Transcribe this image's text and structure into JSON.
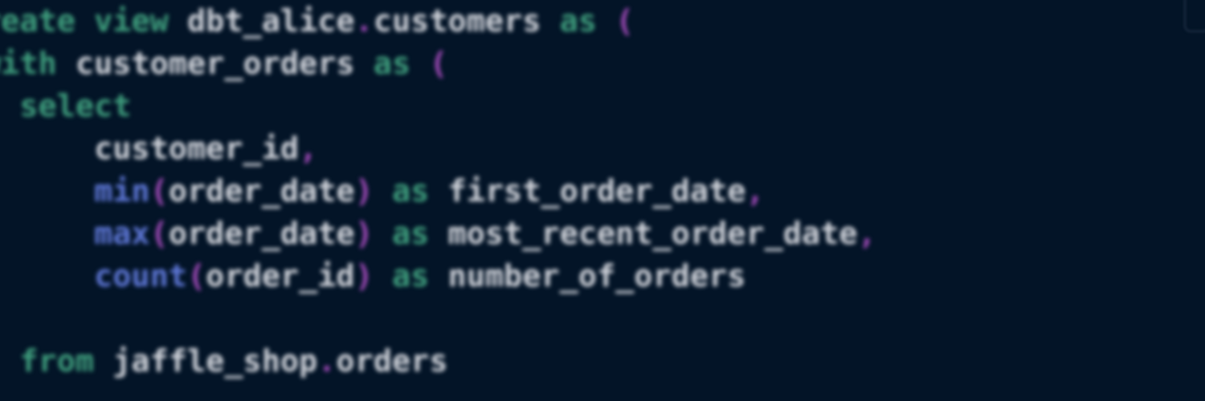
{
  "editor": {
    "language": "sql",
    "colors": {
      "background": "#031427",
      "keyword": "#3f9e7d",
      "identifier": "#d2d5dc",
      "function": "#5f78d8",
      "punctuation": "#a04ab8"
    },
    "lines": [
      [
        {
          "t": "reate",
          "c": "kw"
        },
        {
          "t": " ",
          "c": "ident"
        },
        {
          "t": "view",
          "c": "kw"
        },
        {
          "t": " dbt_alice",
          "c": "ident"
        },
        {
          "t": ".",
          "c": "punct"
        },
        {
          "t": "customers",
          "c": "ident"
        },
        {
          "t": " ",
          "c": "ident"
        },
        {
          "t": "as",
          "c": "kw"
        },
        {
          "t": " ",
          "c": "ident"
        },
        {
          "t": "(",
          "c": "punct"
        }
      ],
      [
        {
          "t": "with",
          "c": "kw"
        },
        {
          "t": " customer_orders ",
          "c": "ident"
        },
        {
          "t": "as",
          "c": "kw"
        },
        {
          "t": " ",
          "c": "ident"
        },
        {
          "t": "(",
          "c": "punct"
        }
      ],
      [
        {
          "t": "  ",
          "c": "ident"
        },
        {
          "t": "select",
          "c": "kw"
        }
      ],
      [
        {
          "t": "      customer_id",
          "c": "ident"
        },
        {
          "t": ",",
          "c": "punct"
        }
      ],
      [
        {
          "t": "      ",
          "c": "ident"
        },
        {
          "t": "min",
          "c": "fn"
        },
        {
          "t": "(",
          "c": "punct"
        },
        {
          "t": "order_date",
          "c": "ident"
        },
        {
          "t": ")",
          "c": "punct"
        },
        {
          "t": " ",
          "c": "ident"
        },
        {
          "t": "as",
          "c": "kw"
        },
        {
          "t": " first_order_date",
          "c": "ident"
        },
        {
          "t": ",",
          "c": "punct"
        }
      ],
      [
        {
          "t": "      ",
          "c": "ident"
        },
        {
          "t": "max",
          "c": "fn"
        },
        {
          "t": "(",
          "c": "punct"
        },
        {
          "t": "order_date",
          "c": "ident"
        },
        {
          "t": ")",
          "c": "punct"
        },
        {
          "t": " ",
          "c": "ident"
        },
        {
          "t": "as",
          "c": "kw"
        },
        {
          "t": " most_recent_order_date",
          "c": "ident"
        },
        {
          "t": ",",
          "c": "punct"
        }
      ],
      [
        {
          "t": "      ",
          "c": "ident"
        },
        {
          "t": "count",
          "c": "fn"
        },
        {
          "t": "(",
          "c": "punct"
        },
        {
          "t": "order_id",
          "c": "ident"
        },
        {
          "t": ")",
          "c": "punct"
        },
        {
          "t": " ",
          "c": "ident"
        },
        {
          "t": "as",
          "c": "kw"
        },
        {
          "t": " number_of_orders",
          "c": "ident"
        }
      ],
      [],
      [
        {
          "t": "  ",
          "c": "ident"
        },
        {
          "t": "from",
          "c": "kw"
        },
        {
          "t": " jaffle_shop",
          "c": "ident"
        },
        {
          "t": ".",
          "c": "punct"
        },
        {
          "t": "orders",
          "c": "ident"
        }
      ]
    ]
  }
}
